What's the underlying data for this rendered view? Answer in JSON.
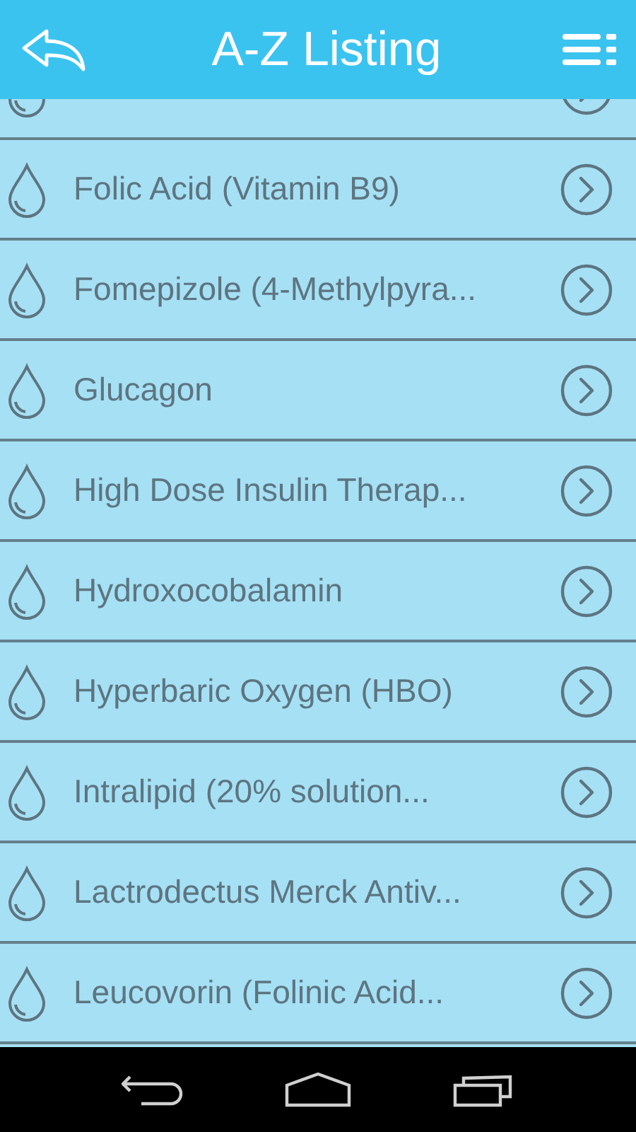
{
  "header": {
    "title": "A-Z Listing"
  },
  "items": [
    {
      "kind": "partial"
    },
    {
      "label": "Folic Acid (Vitamin B9)"
    },
    {
      "label": "Fomepizole (4-Methylpyra..."
    },
    {
      "label": "Glucagon"
    },
    {
      "label": "High Dose Insulin Therap..."
    },
    {
      "label": "Hydroxocobalamin"
    },
    {
      "label": "Hyperbaric Oxygen (HBO)"
    },
    {
      "label": "Intralipid (20% solution..."
    },
    {
      "label": "Lactrodectus Merck Antiv..."
    },
    {
      "label": "Leucovorin (Folinic Acid..."
    }
  ]
}
